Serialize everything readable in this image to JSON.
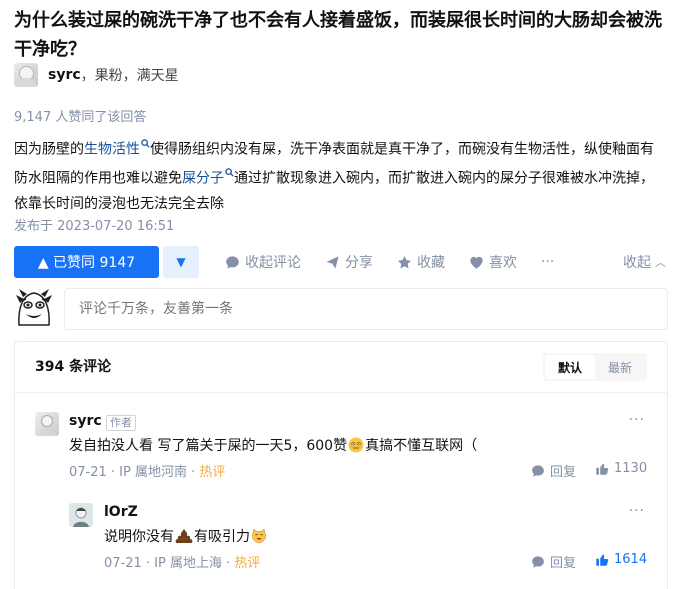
{
  "question": {
    "title": "为什么装过屎的碗洗干净了也不会有人接着盛饭，而装屎很长时间的大肠却会被洗干净吃？"
  },
  "answer": {
    "author_name": "syrc",
    "author_bio": "，果粉，满天星",
    "upvote_summary": "9,147 人赞同了该回答",
    "content": {
      "p1": "因为肠壁的",
      "kw1": "生物活性",
      "p2": "使得肠组织内没有屎，洗干净表面就是真干净了，而碗没有生物活性，纵使釉面有防水阻隔的作用也难以避免",
      "kw2": "屎分子",
      "p3": "通过扩散现象进入碗内，而扩散进入碗内的屎分子很难被水冲洗掉，依靠长时间的浸泡也无法完全去除"
    },
    "publish_time": "发布于 2023-07-20 16:51"
  },
  "actions": {
    "vote_up_label": "▲ 已赞同 9147",
    "vote_down_label": "▼",
    "collapse_comments": "收起评论",
    "share": "分享",
    "favorite": "收藏",
    "like": "喜欢",
    "more": "···",
    "collapse": "收起",
    "collapse_chevron": "︿"
  },
  "comment_input": {
    "placeholder": "评论千万条，友善第一条"
  },
  "comments": {
    "count_label": "394 条评论",
    "sort_default": "默认",
    "sort_latest": "最新",
    "items": [
      {
        "author": "syrc",
        "tag": "作者",
        "text_before": "发自拍没人看 写了篇关于屎的一天5，600赞",
        "text_after": "真搞不懂互联网（",
        "date": "07-21",
        "location": "· IP 属地河南 ·",
        "hot": "热评",
        "reply": "回复",
        "likes": "1130",
        "more": "···"
      },
      {
        "author": "lOrZ",
        "text_before": "说明你没有",
        "text_middle": "有吸引力",
        "date": "07-21",
        "location": "· IP 属地上海 ·",
        "hot": "热评",
        "reply": "回复",
        "likes": "1614",
        "more": "···"
      }
    ]
  },
  "colors": {
    "brand_blue": "#1772f6",
    "link_blue": "#175199",
    "meta_gray": "#8590a6",
    "hot_orange": "#f1a940"
  }
}
